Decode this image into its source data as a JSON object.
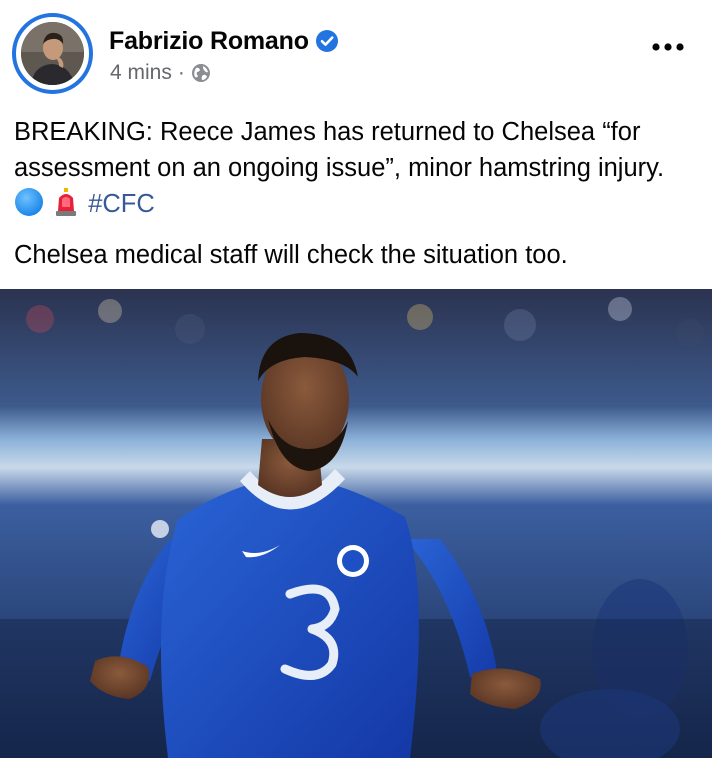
{
  "post": {
    "author": "Fabrizio Romano",
    "time": "4 mins",
    "separator": "·",
    "text_line_1": "BREAKING: Reece James has returned to Chelsea “for assessment on an ongoing issue”, minor hamstring injury.",
    "hashtag": "#CFC",
    "text_line_2": "Chelsea medical staff will check the situation too."
  },
  "icons": {
    "verified": "verified-badge-icon",
    "audience": "globe-icon",
    "more": "more-options-icon",
    "emoji_1": "blue-circle-emoji",
    "emoji_2": "siren-emoji"
  },
  "colors": {
    "accent": "#2374e1",
    "hashtag": "#385898",
    "muted": "#65676b",
    "kit_blue": "#1f4fc4"
  }
}
